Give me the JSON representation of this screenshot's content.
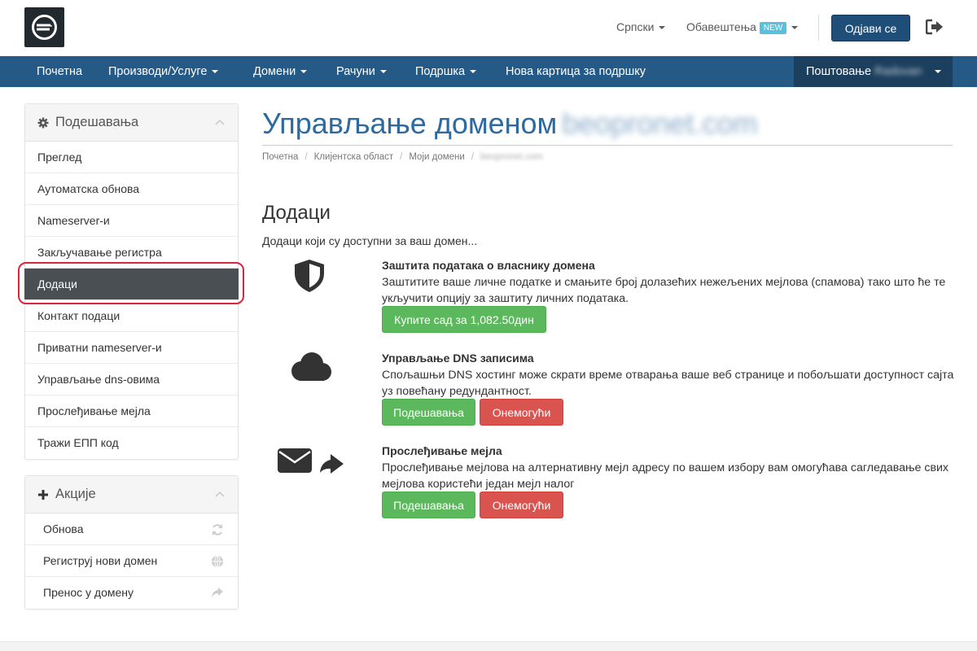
{
  "header": {
    "language": "Српски",
    "notifications": "Обавештења",
    "new_badge": "NEW",
    "logout_label": "Одјави се"
  },
  "nav": {
    "items": [
      {
        "label": "Почетна",
        "dropdown": false
      },
      {
        "label": "Производи/Услуге",
        "dropdown": true
      },
      {
        "label": "Домени",
        "dropdown": true
      },
      {
        "label": "Рачуни",
        "dropdown": true
      },
      {
        "label": "Подршка",
        "dropdown": true
      },
      {
        "label": "Нова картица за подршку",
        "dropdown": false
      }
    ],
    "greeting": "Поштовање",
    "user_name": "Radovan"
  },
  "sidebar": {
    "settings_title": "Подешавања",
    "settings_items": [
      {
        "label": "Преглед"
      },
      {
        "label": "Аутоматска обнова"
      },
      {
        "label": "Nameserver-и"
      },
      {
        "label": "Закључавање регистра"
      },
      {
        "label": "Додаци",
        "active": true
      },
      {
        "label": "Контакт подаци"
      },
      {
        "label": "Приватни nameserver-и"
      },
      {
        "label": "Управљање dns-овима"
      },
      {
        "label": "Прослеђивање мејла"
      },
      {
        "label": "Тражи ЕПП код"
      }
    ],
    "actions_title": "Акције",
    "action_items": [
      {
        "label": "Обнова",
        "icon": "refresh-icon"
      },
      {
        "label": "Региструј нови домен",
        "icon": "globe-icon"
      },
      {
        "label": "Пренос у домену",
        "icon": "share-arrow-icon"
      }
    ]
  },
  "main": {
    "title": "Управљање доменом",
    "domain": "beopronet.com",
    "breadcrumb": [
      "Почетна",
      "Клијентска област",
      "Моји домени",
      "beopronet.com"
    ],
    "section_title": "Додаци",
    "section_desc": "Додаци који су доступни за ваш домен...",
    "addons": [
      {
        "icon": "shield-icon",
        "title": "Заштита података о власнику домена",
        "text": "Заштитите ваше личне податке и смањите број долазећих нежељених мејлова (спамова) тако што ће те укључити опцију за заштиту личних података.",
        "buy_label": "Купите сад за 1,082.50дин"
      },
      {
        "icon": "cloud-icon",
        "title": "Управљање DNS записима",
        "text": "Спољашњи DNS хостинг може скрати време отварања ваше веб странице и побољшати доступност сајта уз повећану редундантност.",
        "settings_label": "Подешавања",
        "disable_label": "Онемогући"
      },
      {
        "icon": "envelope-forward-icon",
        "title": "Прослеђивање мејла",
        "text": "Прослеђивање мејлова на алтернативну мејл адресу по вашем избору вам омогућава сагледавање свих мејлова користећи један мејл налог",
        "settings_label": "Подешавања",
        "disable_label": "Онемогући"
      }
    ]
  },
  "colors": {
    "nav_bg": "#265a86",
    "nav_dark": "#1d3f5e",
    "title_blue": "#2d6a9f",
    "green": "#5cb85c",
    "red": "#d9534f",
    "highlight": "#d7263d"
  }
}
